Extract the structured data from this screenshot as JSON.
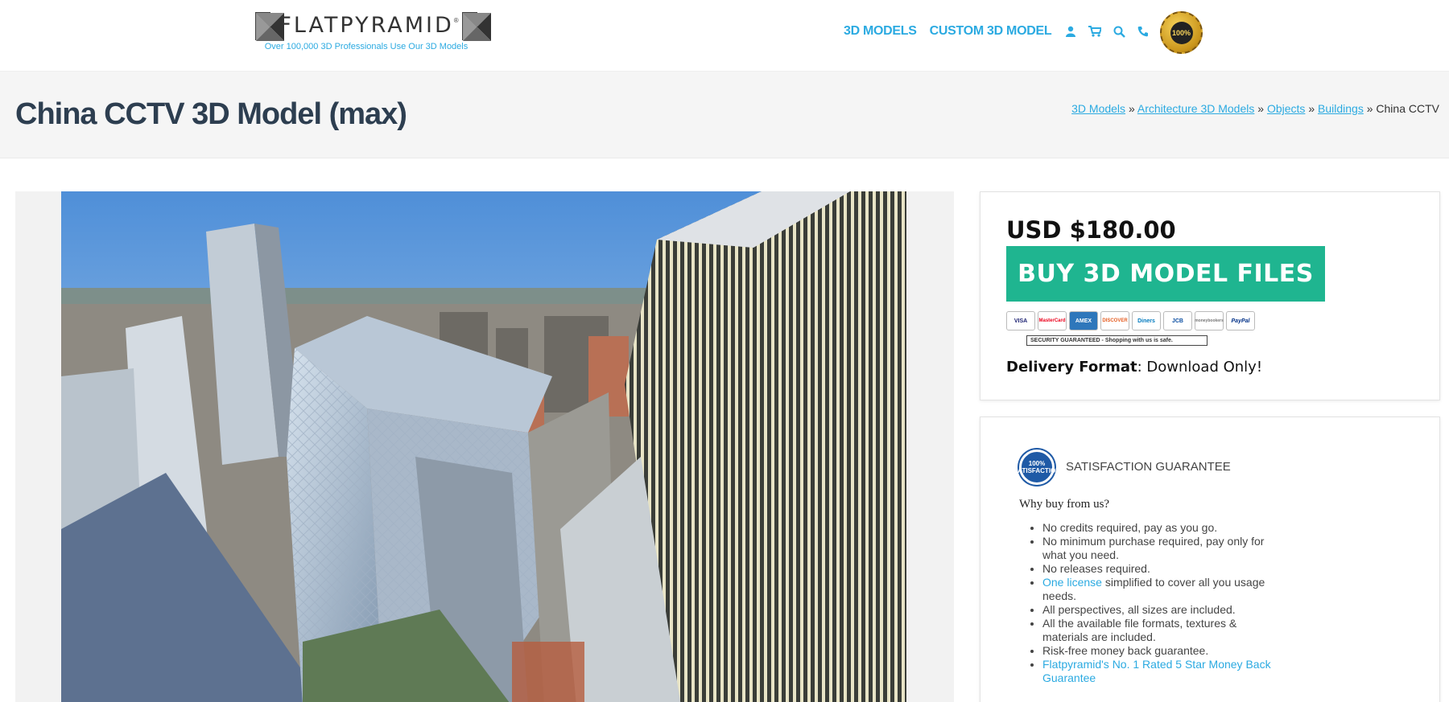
{
  "header": {
    "logo_text": "FLATPYRAMID",
    "logo_mark": "®",
    "tagline": "Over 100,000 3D Professionals Use Our 3D Models",
    "nav": [
      "3D MODELS",
      "CUSTOM 3D MODEL"
    ],
    "icons": [
      "user-icon",
      "cart-icon",
      "search-icon",
      "phone-icon"
    ],
    "badge_text": "100%",
    "accent": "#2baae1"
  },
  "title_bar": {
    "title": "China CCTV 3D Model (max)",
    "breadcrumb": [
      "3D Models",
      "Architecture 3D Models",
      "Objects",
      "Buildings"
    ],
    "separator": "»",
    "current": "China CCTV"
  },
  "purchase": {
    "price": "USD $180.00",
    "buy_label": "BUY 3D MODEL FILES",
    "buy_color": "#1fb590",
    "payment_methods": [
      "VISA",
      "MasterCard",
      "AMEX",
      "DISCOVER",
      "Diners",
      "JCB",
      "moneybookers",
      "PayPal"
    ],
    "security_text": "SECURITY GUARANTEED - Shopping with us is safe.",
    "delivery_label": "Delivery Format",
    "delivery_value": ": Download Only!"
  },
  "guarantee": {
    "seal_text": "100% SATISFACTION",
    "title": "SATISFACTION GUARANTEE",
    "why_heading": "Why buy from us?",
    "items": [
      {
        "link": "",
        "text": "No credits required, pay as you go."
      },
      {
        "link": "",
        "text": "No minimum purchase required, pay only for what you need."
      },
      {
        "link": "",
        "text": "No releases required."
      },
      {
        "link": "One license",
        "text": " simplified to cover all you usage needs."
      },
      {
        "link": "",
        "text": "All perspectives, all sizes are included."
      },
      {
        "link": "",
        "text": "All the available file formats, textures & materials are included."
      },
      {
        "link": "",
        "text": "Risk-free money back guarantee."
      },
      {
        "link": "Flatpyramid's No. 1 Rated 5 Star Money Back Guarantee",
        "text": ""
      }
    ]
  }
}
